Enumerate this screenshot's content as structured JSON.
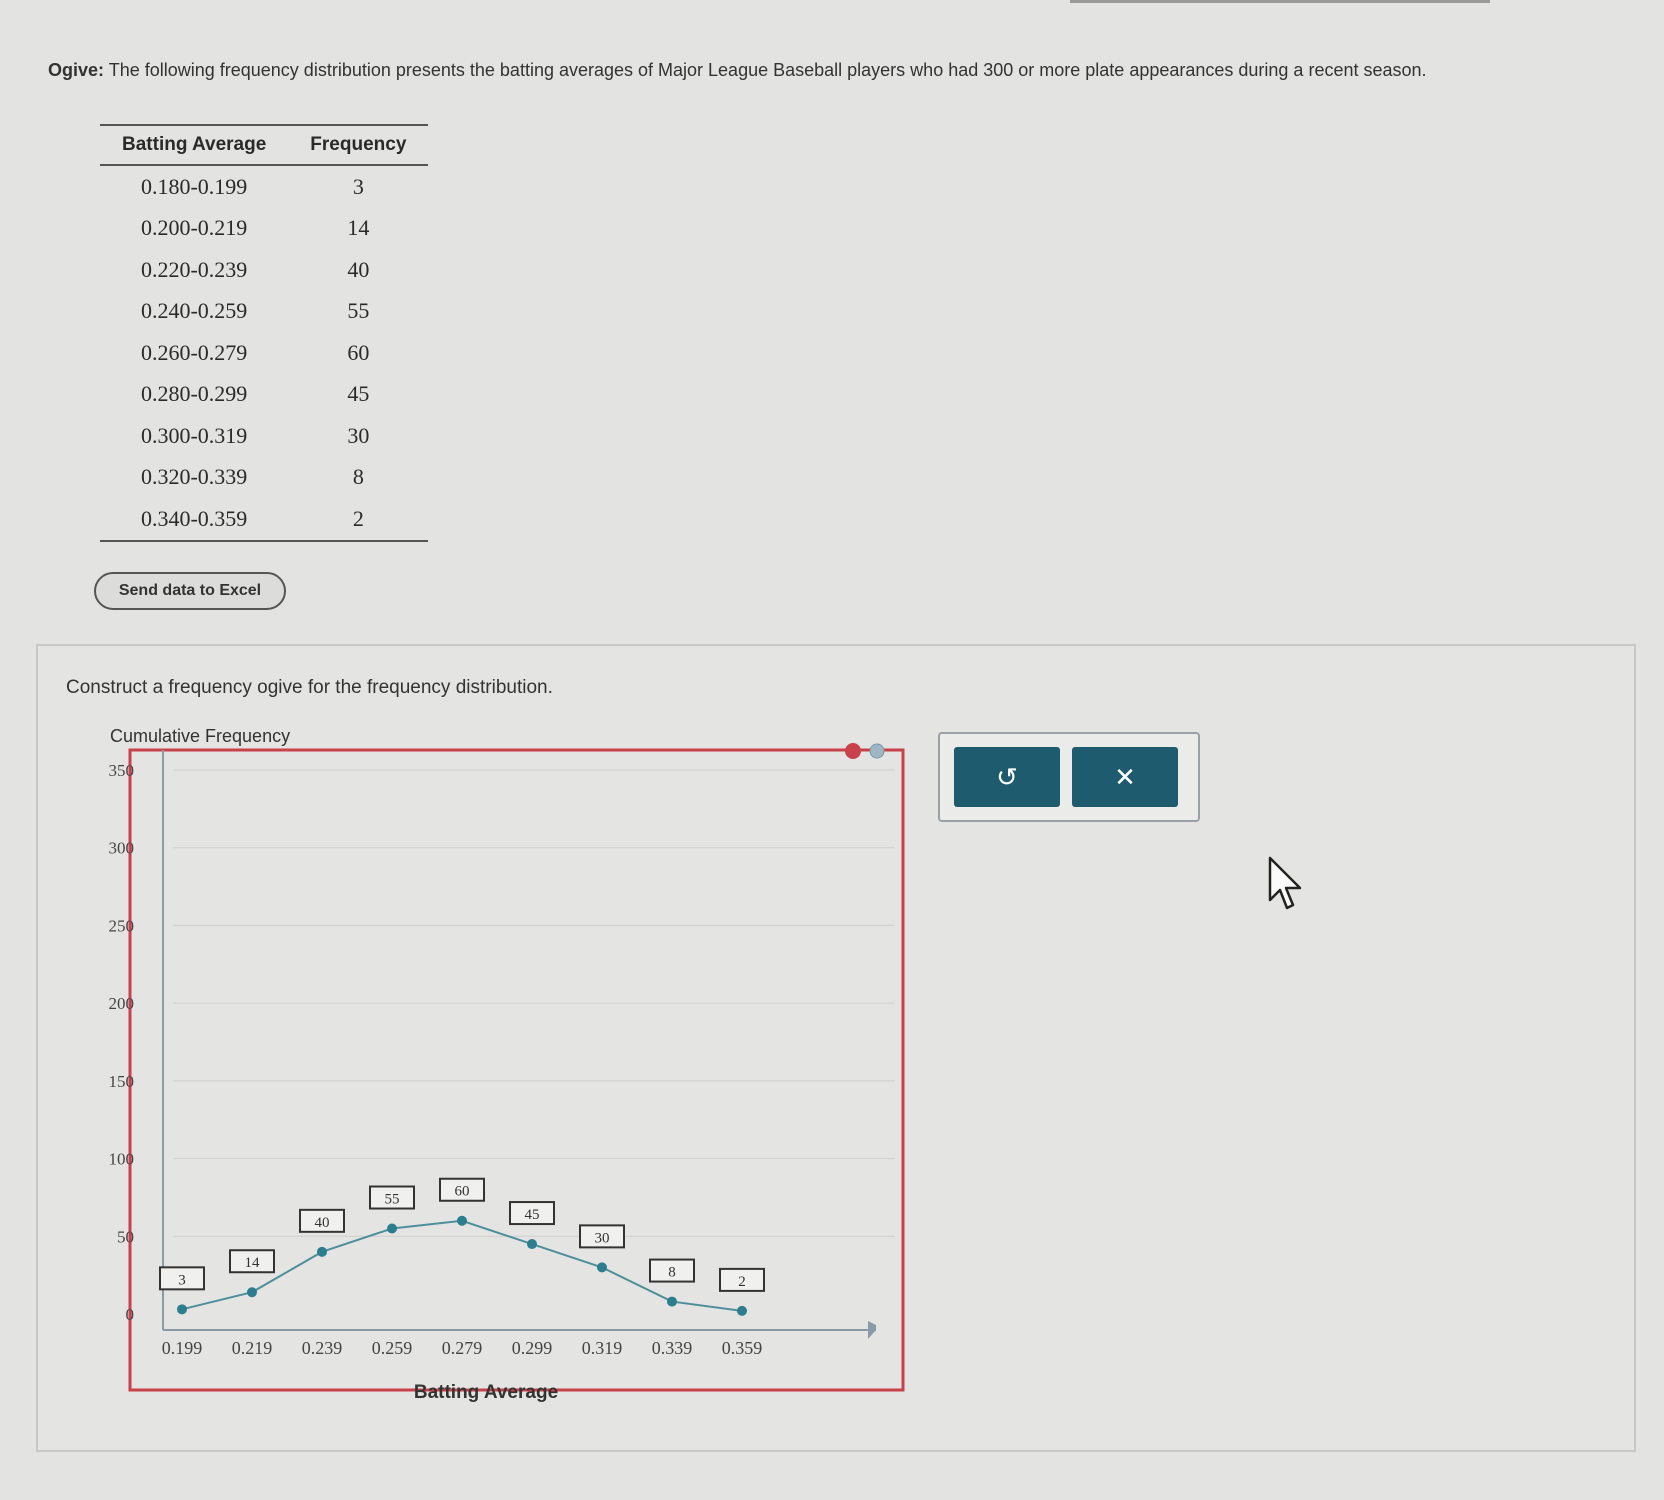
{
  "problem": {
    "lead": "Ogive:",
    "text": "The following frequency distribution presents the batting averages of Major League Baseball players who had 300 or more plate appearances during a recent season."
  },
  "table": {
    "headers": [
      "Batting Average",
      "Frequency"
    ],
    "rows": [
      [
        "0.180-0.199",
        "3"
      ],
      [
        "0.200-0.219",
        "14"
      ],
      [
        "0.220-0.239",
        "40"
      ],
      [
        "0.240-0.259",
        "55"
      ],
      [
        "0.260-0.279",
        "60"
      ],
      [
        "0.280-0.299",
        "45"
      ],
      [
        "0.300-0.319",
        "30"
      ],
      [
        "0.320-0.339",
        "8"
      ],
      [
        "0.340-0.359",
        "2"
      ]
    ]
  },
  "excel_button": "Send data to Excel",
  "instruction": "Construct a frequency ogive for the frequency distribution.",
  "tools": {
    "undo_icon": "undo-icon",
    "undo_glyph": "↺",
    "clear_icon": "close-icon",
    "clear_glyph": "✕"
  },
  "colors": {
    "accent": "#1f5b6e",
    "chart_frame": "#c9414a",
    "point": "#2c7e8e",
    "line": "#4f8f9c"
  },
  "chart_data": {
    "type": "line",
    "ylabel": "Cumulative Frequency",
    "xlabel": "Batting Average",
    "ylim": [
      0,
      350
    ],
    "yticks": [
      0,
      50,
      100,
      150,
      200,
      250,
      300,
      350
    ],
    "x": [
      "0.199",
      "0.219",
      "0.239",
      "0.259",
      "0.279",
      "0.299",
      "0.319",
      "0.339",
      "0.359"
    ],
    "series": [
      {
        "values": [
          3,
          14,
          40,
          55,
          60,
          45,
          30,
          8,
          2
        ]
      }
    ],
    "point_labels": [
      "3",
      "14",
      "40",
      "55",
      "60",
      "45",
      "30",
      "8",
      "2"
    ],
    "grid": true
  }
}
